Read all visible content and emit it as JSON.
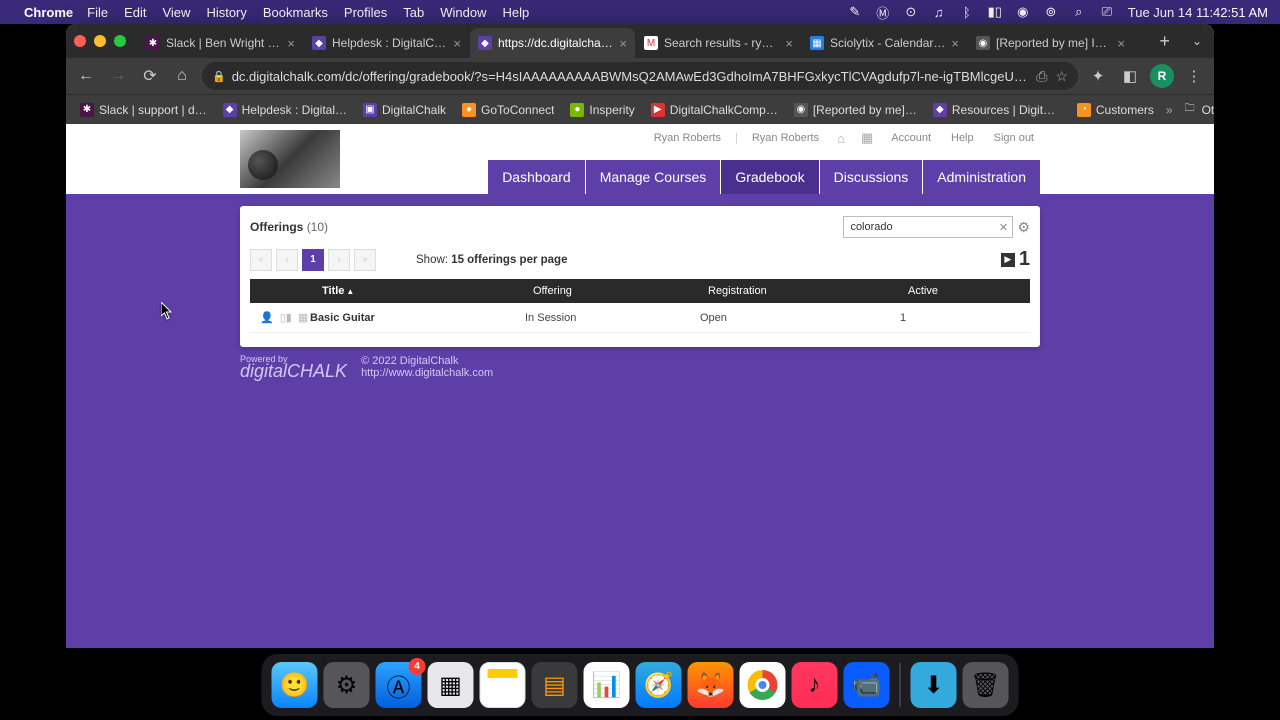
{
  "menubar": {
    "app": "Chrome",
    "items": [
      "File",
      "Edit",
      "View",
      "History",
      "Bookmarks",
      "Profiles",
      "Tab",
      "Window",
      "Help"
    ],
    "clock": "Tue Jun 14  11:42:51 AM"
  },
  "tabs": [
    {
      "label": "Slack | Ben Wright | digi",
      "fav_bg": "#4a154b",
      "fav_txt": "✱"
    },
    {
      "label": "Helpdesk : DigitalChalk",
      "fav_bg": "#5e3fa8",
      "fav_txt": "◆"
    },
    {
      "label": "https://dc.digitalchalk.co",
      "fav_bg": "#5e3fa8",
      "fav_txt": "◆",
      "active": true
    },
    {
      "label": "Search results - ryan.rob",
      "fav_bg": "#fff",
      "fav_txt": "M"
    },
    {
      "label": "Sciolytix - Calendar - Ju",
      "fav_bg": "#2a7de1",
      "fav_txt": "▦"
    },
    {
      "label": "[Reported by me] Issue",
      "fav_bg": "#555",
      "fav_txt": "◉"
    }
  ],
  "toolbar": {
    "url": "dc.digitalchalk.com/dc/offering/gradebook/?s=H4sIAAAAAAAAABWMsQ2AMAwEd3GdhoImA7BHFGxkycTlCVAgdufp7l-ne-igTBMlcgeUXoFfAF2EQ9vWcdyGQ4…",
    "avatar": "R"
  },
  "bookmarks": [
    {
      "label": "Slack | support | d…",
      "bg": "#4a154b",
      "txt": "✱"
    },
    {
      "label": "Helpdesk : Digital…",
      "bg": "#5e3fa8",
      "txt": "◆"
    },
    {
      "label": "DigitalChalk",
      "bg": "#5e3fa8",
      "txt": "▣"
    },
    {
      "label": "GoToConnect",
      "bg": "#f7931e",
      "txt": "●"
    },
    {
      "label": "Insperity",
      "bg": "#7ab800",
      "txt": "●"
    },
    {
      "label": "DigitalChalkComp…",
      "bg": "#d33",
      "txt": "▶"
    },
    {
      "label": "[Reported by me]…",
      "bg": "#555",
      "txt": "◉"
    },
    {
      "label": "Resources | Digita…",
      "bg": "#5e3fa8",
      "txt": "◆"
    },
    {
      "label": "Customers",
      "bg": "#f7931e",
      "txt": "◔"
    }
  ],
  "bookmarks_more": "»",
  "bookmarks_other": "Other Bookmarks",
  "apphead": {
    "user1": "Ryan Roberts",
    "user2": "Ryan Roberts",
    "account": "Account",
    "help": "Help",
    "signout": "Sign out"
  },
  "nav": {
    "items": [
      "Dashboard",
      "Manage Courses",
      "Gradebook",
      "Discussions",
      "Administration"
    ],
    "active": 2
  },
  "panel": {
    "title": "Offerings",
    "count": "(10)",
    "search_value": "colorado",
    "page": "1",
    "show_prefix": "Show: ",
    "show_bold": "15 offerings per page",
    "right_num": "1"
  },
  "table": {
    "headers": {
      "title": "Title",
      "offering": "Offering",
      "registration": "Registration",
      "active": "Active"
    },
    "rows": [
      {
        "title": "Basic Guitar",
        "offering": "In Session",
        "registration": "Open",
        "active": "1"
      }
    ]
  },
  "footer": {
    "powered_small": "Powered by",
    "powered_brand": "digitalCHALK",
    "copyright": "© 2022 DigitalChalk",
    "url": "http://www.digitalchalk.com"
  },
  "dock": {
    "badge": "4"
  }
}
